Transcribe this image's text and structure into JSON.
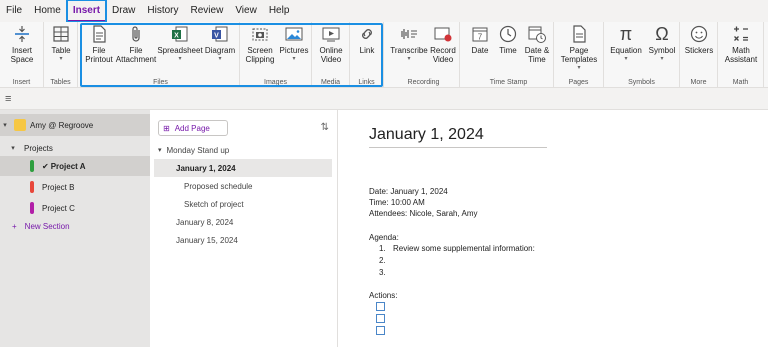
{
  "menubar": {
    "items": [
      "File",
      "Home",
      "Insert",
      "Draw",
      "History",
      "Review",
      "View",
      "Help"
    ],
    "active": "Insert"
  },
  "ribbon": {
    "groups": {
      "insert": {
        "label": "Insert",
        "buttons": [
          {
            "label": "Insert Space",
            "icon": "insert-space-icon"
          }
        ]
      },
      "tables": {
        "label": "Tables",
        "buttons": [
          {
            "label": "Table",
            "icon": "table-icon"
          }
        ]
      },
      "files": {
        "label": "Files",
        "buttons": [
          {
            "label": "File Printout",
            "icon": "file-printout-icon"
          },
          {
            "label": "File Attachment",
            "icon": "paperclip-icon"
          },
          {
            "label": "Spreadsheet",
            "icon": "spreadsheet-icon"
          },
          {
            "label": "Diagram",
            "icon": "diagram-icon"
          }
        ]
      },
      "images": {
        "label": "Images",
        "buttons": [
          {
            "label": "Screen Clipping",
            "icon": "screen-clipping-icon"
          },
          {
            "label": "Pictures",
            "icon": "pictures-icon"
          }
        ]
      },
      "media": {
        "label": "Media",
        "buttons": [
          {
            "label": "Online Video",
            "icon": "online-video-icon"
          }
        ]
      },
      "links": {
        "label": "Links",
        "buttons": [
          {
            "label": "Link",
            "icon": "link-icon"
          }
        ]
      },
      "recording": {
        "label": "Recording",
        "buttons": [
          {
            "label": "Transcribe",
            "icon": "transcribe-icon"
          },
          {
            "label": "Record Video",
            "icon": "record-video-icon"
          }
        ]
      },
      "timestamp": {
        "label": "Time Stamp",
        "buttons": [
          {
            "label": "Date",
            "icon": "calendar-icon"
          },
          {
            "label": "Time",
            "icon": "clock-icon"
          },
          {
            "label": "Date & Time",
            "icon": "date-time-icon"
          }
        ]
      },
      "pages": {
        "label": "Pages",
        "buttons": [
          {
            "label": "Page Templates",
            "icon": "page-templates-icon"
          }
        ]
      },
      "symbols": {
        "label": "Symbols",
        "buttons": [
          {
            "label": "Equation",
            "icon": "pi-icon",
            "glyph": "π"
          },
          {
            "label": "Symbol",
            "icon": "omega-icon",
            "glyph": "Ω"
          }
        ]
      },
      "more": {
        "label": "More",
        "buttons": [
          {
            "label": "Stickers",
            "icon": "smiley-icon"
          }
        ]
      },
      "math": {
        "label": "Math",
        "buttons": [
          {
            "label": "Math Assistant",
            "icon": "math-assistant-icon"
          }
        ]
      }
    }
  },
  "notebooks": {
    "notebook_name": "Amy @ Regroove",
    "section_group": "Projects",
    "sections": [
      {
        "label": "Project A",
        "color": "#2e9e3e",
        "selected": true
      },
      {
        "label": "Project B",
        "color": "#e8473a",
        "selected": false
      },
      {
        "label": "Project C",
        "color": "#b21fa8",
        "selected": false
      }
    ],
    "new_section": "New Section"
  },
  "pages": {
    "add_page": "Add Page",
    "list": [
      {
        "label": "Monday Stand up",
        "level": 0,
        "selected": false,
        "chevron": true
      },
      {
        "label": "January 1, 2024",
        "level": 1,
        "selected": true
      },
      {
        "label": "Proposed schedule",
        "level": 2,
        "selected": false
      },
      {
        "label": "Sketch of project",
        "level": 2,
        "selected": false
      },
      {
        "label": "January 8, 2024",
        "level": 1,
        "selected": false
      },
      {
        "label": "January 15, 2024",
        "level": 1,
        "selected": false
      }
    ]
  },
  "note": {
    "title": "January 1, 2024",
    "date_line": "Date: January 1, 2024",
    "time_line": "Time: 10:00 AM",
    "attendees_line": "Attendees: Nicole, Sarah, Amy",
    "agenda_heading": "Agenda:",
    "agenda_items": [
      "Review some supplemental information:",
      "",
      ""
    ],
    "actions_heading": "Actions:",
    "action_checkboxes": 3
  },
  "colors": {
    "accent": "#7719aa",
    "highlight": "#1a8fe3"
  }
}
